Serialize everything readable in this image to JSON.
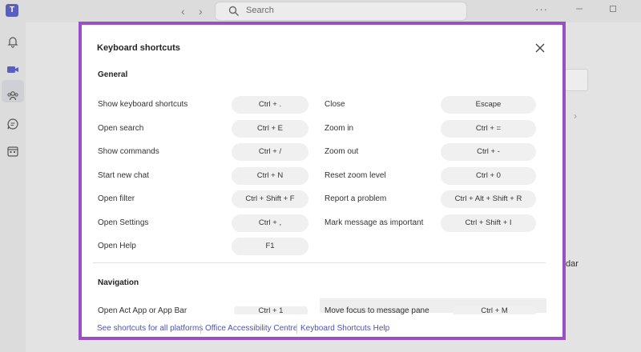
{
  "topbar": {
    "app_logo": "teams-logo",
    "search_placeholder": "Search",
    "more_label": "···"
  },
  "rail": {
    "icons": [
      "bell-icon",
      "video-icon",
      "people-icon",
      "chat-icon",
      "calendar-icon"
    ]
  },
  "background": {
    "partial_text": "dar"
  },
  "modal": {
    "title": "Keyboard shortcuts",
    "sections": {
      "general": {
        "title": "General",
        "left": [
          {
            "label": "Show keyboard shortcuts",
            "keys": "Ctrl + ."
          },
          {
            "label": "Open search",
            "keys": "Ctrl + E"
          },
          {
            "label": "Show commands",
            "keys": "Ctrl + /"
          },
          {
            "label": "Start new chat",
            "keys": "Ctrl + N"
          },
          {
            "label": "Open filter",
            "keys": "Ctrl + Shift + F"
          },
          {
            "label": "Open Settings",
            "keys": "Ctrl + ,"
          },
          {
            "label": "Open Help",
            "keys": "F1"
          }
        ],
        "right": [
          {
            "label": "Close",
            "keys": "Escape"
          },
          {
            "label": "Zoom in",
            "keys": "Ctrl + ="
          },
          {
            "label": "Zoom out",
            "keys": "Ctrl + -"
          },
          {
            "label": "Reset zoom level",
            "keys": "Ctrl + 0"
          },
          {
            "label": "Report a problem",
            "keys": "Ctrl + Alt + Shift + R"
          },
          {
            "label": "Mark message as important",
            "keys": "Ctrl + Shift + I"
          }
        ]
      },
      "navigation": {
        "title": "Navigation",
        "left": [
          {
            "label": "Open Act App or App Bar",
            "keys": "Ctrl + 1"
          }
        ],
        "right": [
          {
            "label": "Move focus to message pane",
            "keys": "Ctrl + M"
          }
        ]
      }
    },
    "footer": {
      "links": [
        "See shortcuts for all platforms",
        "Office Accessibility Centre",
        "Keyboard Shortcuts Help"
      ]
    }
  },
  "colors": {
    "accent": "#9b4fc7",
    "link": "#4f52b2",
    "pill_bg": "#f0f0f0"
  }
}
